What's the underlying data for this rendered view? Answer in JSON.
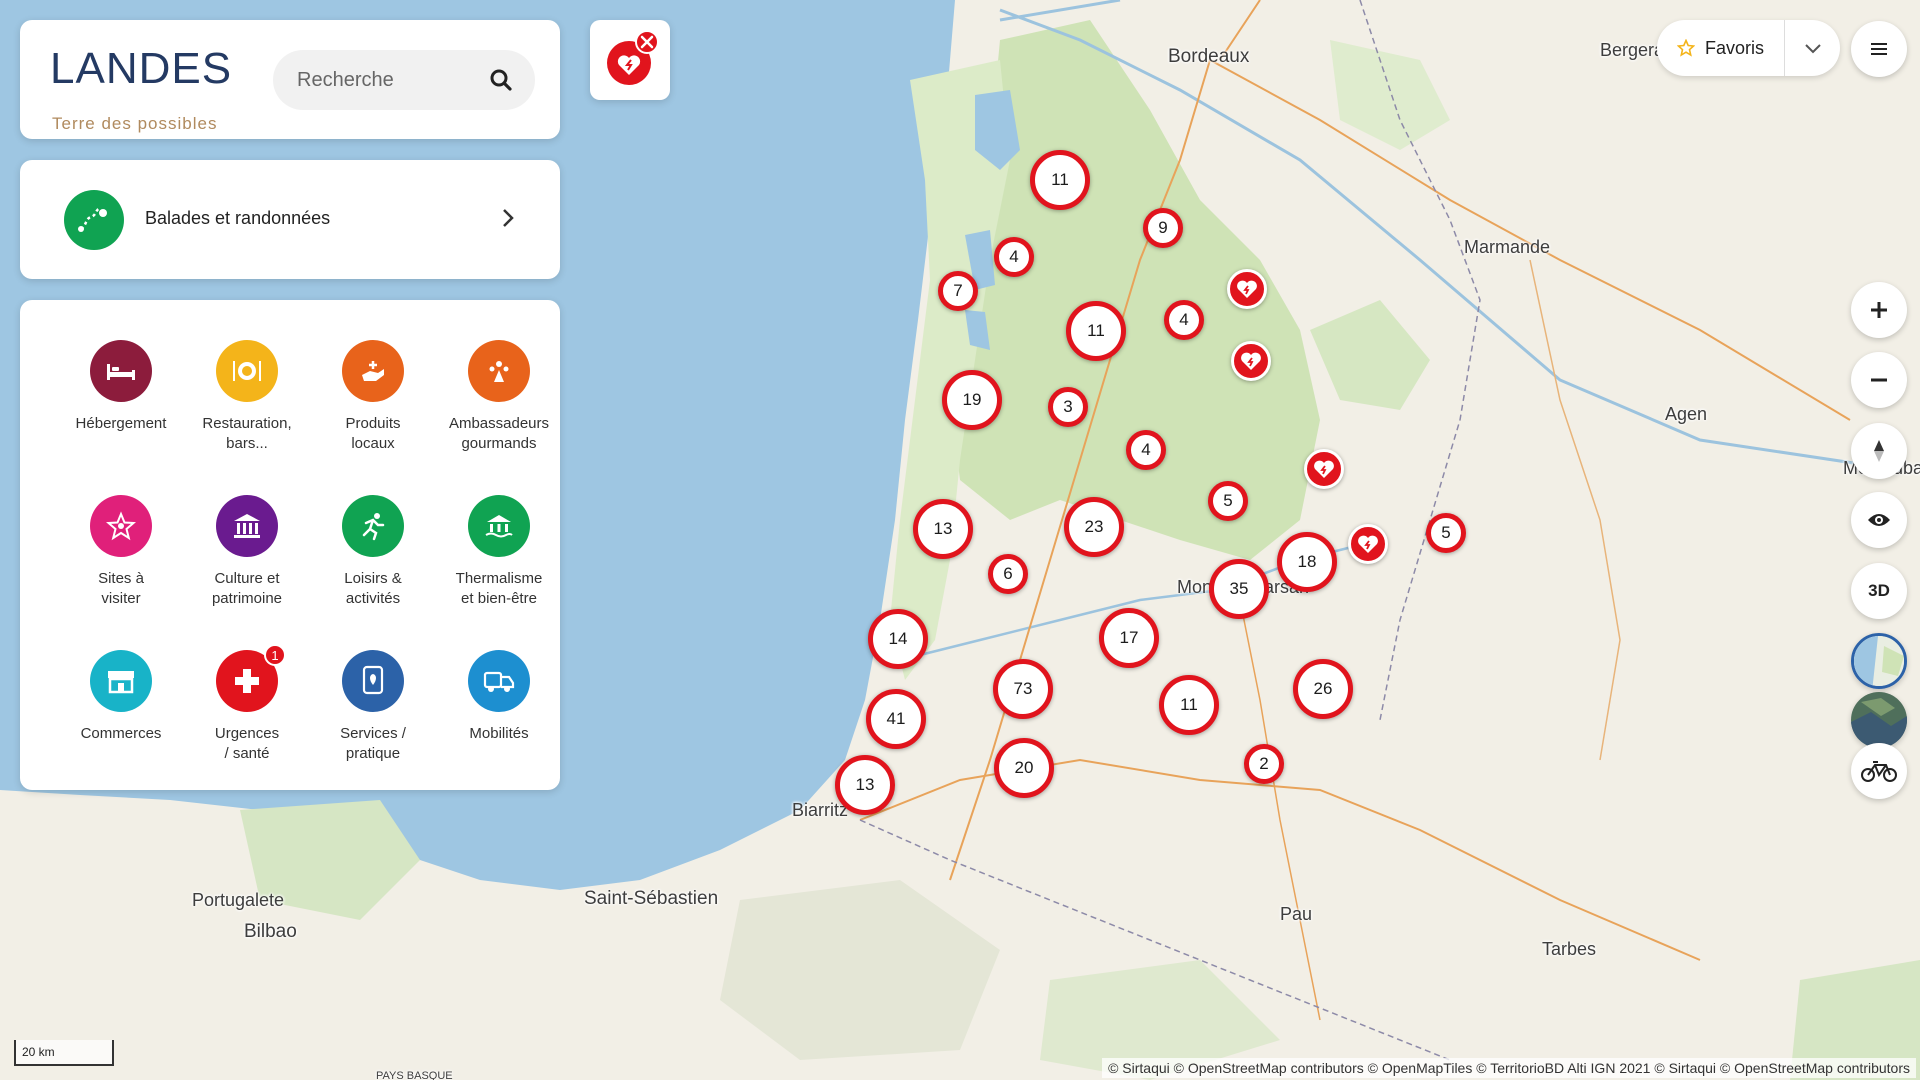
{
  "brand": {
    "logo_word": "LANDES",
    "logo_tagline": "Terre des possibles"
  },
  "search": {
    "placeholder": "Recherche"
  },
  "route": {
    "label": "Balades et randonnées"
  },
  "categories": [
    {
      "label": "Hébergement",
      "icon": "bed-icon",
      "color": "#8c1c3c"
    },
    {
      "label": "Restauration,\nbars...",
      "icon": "plate-icon",
      "color": "#f4b41a"
    },
    {
      "label": "Produits\nlocaux",
      "icon": "hand-icon",
      "color": "#e8631b"
    },
    {
      "label": "Ambassadeurs\ngourmands",
      "icon": "sparkle-icon",
      "color": "#e8631b"
    },
    {
      "label": "Sites à\nvisiter",
      "icon": "star-icon",
      "color": "#e0207a"
    },
    {
      "label": "Culture et\npatrimoine",
      "icon": "museum-icon",
      "color": "#6a1b8f"
    },
    {
      "label": "Loisirs &\nactivités",
      "icon": "runner-icon",
      "color": "#10a352"
    },
    {
      "label": "Thermalisme\net bien-être",
      "icon": "spa-icon",
      "color": "#10a352"
    },
    {
      "label": "Commerces",
      "icon": "shop-icon",
      "color": "#18b3c8"
    },
    {
      "label": "Urgences\n/ santé",
      "icon": "medical-cross-icon",
      "color": "#e1141d",
      "badge": "1"
    },
    {
      "label": "Services /\npratique",
      "icon": "map-pin-icon",
      "color": "#2c62a8"
    },
    {
      "label": "Mobilités",
      "icon": "vehicle-icon",
      "color": "#1d8fd0"
    }
  ],
  "favorites": {
    "label": "Favoris"
  },
  "controls": {
    "view_3d": "3D"
  },
  "places": [
    {
      "name": "Bordeaux"
    },
    {
      "name": "Bergerac"
    },
    {
      "name": "Marmande"
    },
    {
      "name": "Agen"
    },
    {
      "name": "Montauban"
    },
    {
      "name": "Mont-de-Marsan"
    },
    {
      "name": "Biarritz"
    },
    {
      "name": "Saint-Sébastien"
    },
    {
      "name": "Portugalete"
    },
    {
      "name": "Bilbao"
    },
    {
      "name": "Pau"
    },
    {
      "name": "Tarbes"
    },
    {
      "name": "PAYS BASQUE"
    }
  ],
  "clusters": [
    "11",
    "9",
    "4",
    "7",
    "11",
    "4",
    "19",
    "3",
    "4",
    "5",
    "13",
    "23",
    "6",
    "18",
    "5",
    "35",
    "14",
    "17",
    "73",
    "11",
    "26",
    "41",
    "20",
    "2",
    "13"
  ],
  "scale": {
    "label": "20 km"
  },
  "attribution": "© Sirtaqui © OpenStreetMap contributors © OpenMapTiles © TerritorioBD Alti IGN 2021 © Sirtaqui © OpenStreetMap contributors",
  "colors": {
    "marker_red": "#e1141d",
    "sea": "#9ec6e2",
    "land": "#f2efe6",
    "forest": "#cde3b5"
  }
}
